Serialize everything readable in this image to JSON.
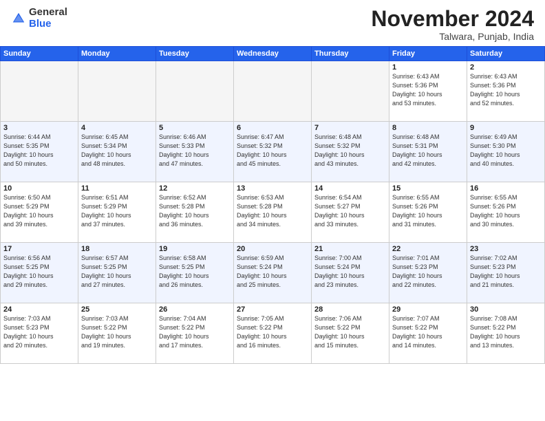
{
  "header": {
    "logo_general": "General",
    "logo_blue": "Blue",
    "month": "November 2024",
    "location": "Talwara, Punjab, India"
  },
  "weekdays": [
    "Sunday",
    "Monday",
    "Tuesday",
    "Wednesday",
    "Thursday",
    "Friday",
    "Saturday"
  ],
  "weeks": [
    [
      {
        "day": "",
        "info": ""
      },
      {
        "day": "",
        "info": ""
      },
      {
        "day": "",
        "info": ""
      },
      {
        "day": "",
        "info": ""
      },
      {
        "day": "",
        "info": ""
      },
      {
        "day": "1",
        "info": "Sunrise: 6:43 AM\nSunset: 5:36 PM\nDaylight: 10 hours\nand 53 minutes."
      },
      {
        "day": "2",
        "info": "Sunrise: 6:43 AM\nSunset: 5:36 PM\nDaylight: 10 hours\nand 52 minutes."
      }
    ],
    [
      {
        "day": "3",
        "info": "Sunrise: 6:44 AM\nSunset: 5:35 PM\nDaylight: 10 hours\nand 50 minutes."
      },
      {
        "day": "4",
        "info": "Sunrise: 6:45 AM\nSunset: 5:34 PM\nDaylight: 10 hours\nand 48 minutes."
      },
      {
        "day": "5",
        "info": "Sunrise: 6:46 AM\nSunset: 5:33 PM\nDaylight: 10 hours\nand 47 minutes."
      },
      {
        "day": "6",
        "info": "Sunrise: 6:47 AM\nSunset: 5:32 PM\nDaylight: 10 hours\nand 45 minutes."
      },
      {
        "day": "7",
        "info": "Sunrise: 6:48 AM\nSunset: 5:32 PM\nDaylight: 10 hours\nand 43 minutes."
      },
      {
        "day": "8",
        "info": "Sunrise: 6:48 AM\nSunset: 5:31 PM\nDaylight: 10 hours\nand 42 minutes."
      },
      {
        "day": "9",
        "info": "Sunrise: 6:49 AM\nSunset: 5:30 PM\nDaylight: 10 hours\nand 40 minutes."
      }
    ],
    [
      {
        "day": "10",
        "info": "Sunrise: 6:50 AM\nSunset: 5:29 PM\nDaylight: 10 hours\nand 39 minutes."
      },
      {
        "day": "11",
        "info": "Sunrise: 6:51 AM\nSunset: 5:29 PM\nDaylight: 10 hours\nand 37 minutes."
      },
      {
        "day": "12",
        "info": "Sunrise: 6:52 AM\nSunset: 5:28 PM\nDaylight: 10 hours\nand 36 minutes."
      },
      {
        "day": "13",
        "info": "Sunrise: 6:53 AM\nSunset: 5:28 PM\nDaylight: 10 hours\nand 34 minutes."
      },
      {
        "day": "14",
        "info": "Sunrise: 6:54 AM\nSunset: 5:27 PM\nDaylight: 10 hours\nand 33 minutes."
      },
      {
        "day": "15",
        "info": "Sunrise: 6:55 AM\nSunset: 5:26 PM\nDaylight: 10 hours\nand 31 minutes."
      },
      {
        "day": "16",
        "info": "Sunrise: 6:55 AM\nSunset: 5:26 PM\nDaylight: 10 hours\nand 30 minutes."
      }
    ],
    [
      {
        "day": "17",
        "info": "Sunrise: 6:56 AM\nSunset: 5:25 PM\nDaylight: 10 hours\nand 29 minutes."
      },
      {
        "day": "18",
        "info": "Sunrise: 6:57 AM\nSunset: 5:25 PM\nDaylight: 10 hours\nand 27 minutes."
      },
      {
        "day": "19",
        "info": "Sunrise: 6:58 AM\nSunset: 5:25 PM\nDaylight: 10 hours\nand 26 minutes."
      },
      {
        "day": "20",
        "info": "Sunrise: 6:59 AM\nSunset: 5:24 PM\nDaylight: 10 hours\nand 25 minutes."
      },
      {
        "day": "21",
        "info": "Sunrise: 7:00 AM\nSunset: 5:24 PM\nDaylight: 10 hours\nand 23 minutes."
      },
      {
        "day": "22",
        "info": "Sunrise: 7:01 AM\nSunset: 5:23 PM\nDaylight: 10 hours\nand 22 minutes."
      },
      {
        "day": "23",
        "info": "Sunrise: 7:02 AM\nSunset: 5:23 PM\nDaylight: 10 hours\nand 21 minutes."
      }
    ],
    [
      {
        "day": "24",
        "info": "Sunrise: 7:03 AM\nSunset: 5:23 PM\nDaylight: 10 hours\nand 20 minutes."
      },
      {
        "day": "25",
        "info": "Sunrise: 7:03 AM\nSunset: 5:22 PM\nDaylight: 10 hours\nand 19 minutes."
      },
      {
        "day": "26",
        "info": "Sunrise: 7:04 AM\nSunset: 5:22 PM\nDaylight: 10 hours\nand 17 minutes."
      },
      {
        "day": "27",
        "info": "Sunrise: 7:05 AM\nSunset: 5:22 PM\nDaylight: 10 hours\nand 16 minutes."
      },
      {
        "day": "28",
        "info": "Sunrise: 7:06 AM\nSunset: 5:22 PM\nDaylight: 10 hours\nand 15 minutes."
      },
      {
        "day": "29",
        "info": "Sunrise: 7:07 AM\nSunset: 5:22 PM\nDaylight: 10 hours\nand 14 minutes."
      },
      {
        "day": "30",
        "info": "Sunrise: 7:08 AM\nSunset: 5:22 PM\nDaylight: 10 hours\nand 13 minutes."
      }
    ]
  ]
}
